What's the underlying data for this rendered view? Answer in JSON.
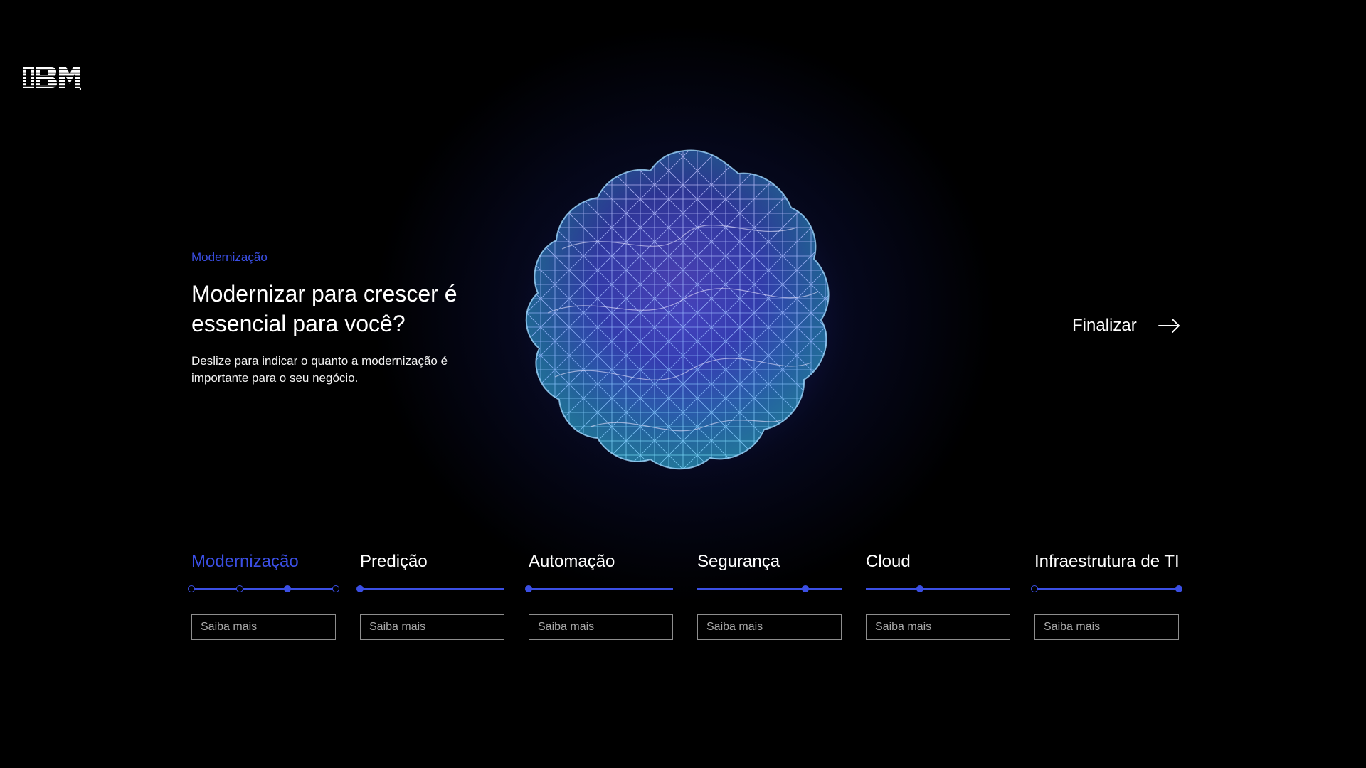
{
  "brand": {
    "logo_text": "IBM",
    "color": "#ffffff"
  },
  "intro": {
    "eyebrow": "Modernização",
    "headline": "Modernizar para crescer é essencial para você?",
    "description": "Deslize para indicar o quanto a modernização é importante para o seu negócio."
  },
  "finish": {
    "label": "Finalizar",
    "icon": "arrow-right-icon"
  },
  "accent_color": "#3b4fe4",
  "topics": [
    {
      "title": "Modernização",
      "active": true,
      "value": 0.667,
      "ticks": [
        0,
        0.333,
        1
      ],
      "button": "Saiba mais"
    },
    {
      "title": "Predição",
      "active": false,
      "value": 0.0,
      "ticks": [],
      "button": "Saiba mais"
    },
    {
      "title": "Automação",
      "active": false,
      "value": 0.0,
      "ticks": [],
      "button": "Saiba mais"
    },
    {
      "title": "Segurança",
      "active": false,
      "value": 0.75,
      "ticks": [],
      "button": "Saiba mais"
    },
    {
      "title": "Cloud",
      "active": false,
      "value": 0.375,
      "ticks": [],
      "button": "Saiba mais"
    },
    {
      "title": "Infraestrutura de TI",
      "active": false,
      "value": 1.0,
      "ticks": [
        0
      ],
      "button": "Saiba mais"
    }
  ]
}
